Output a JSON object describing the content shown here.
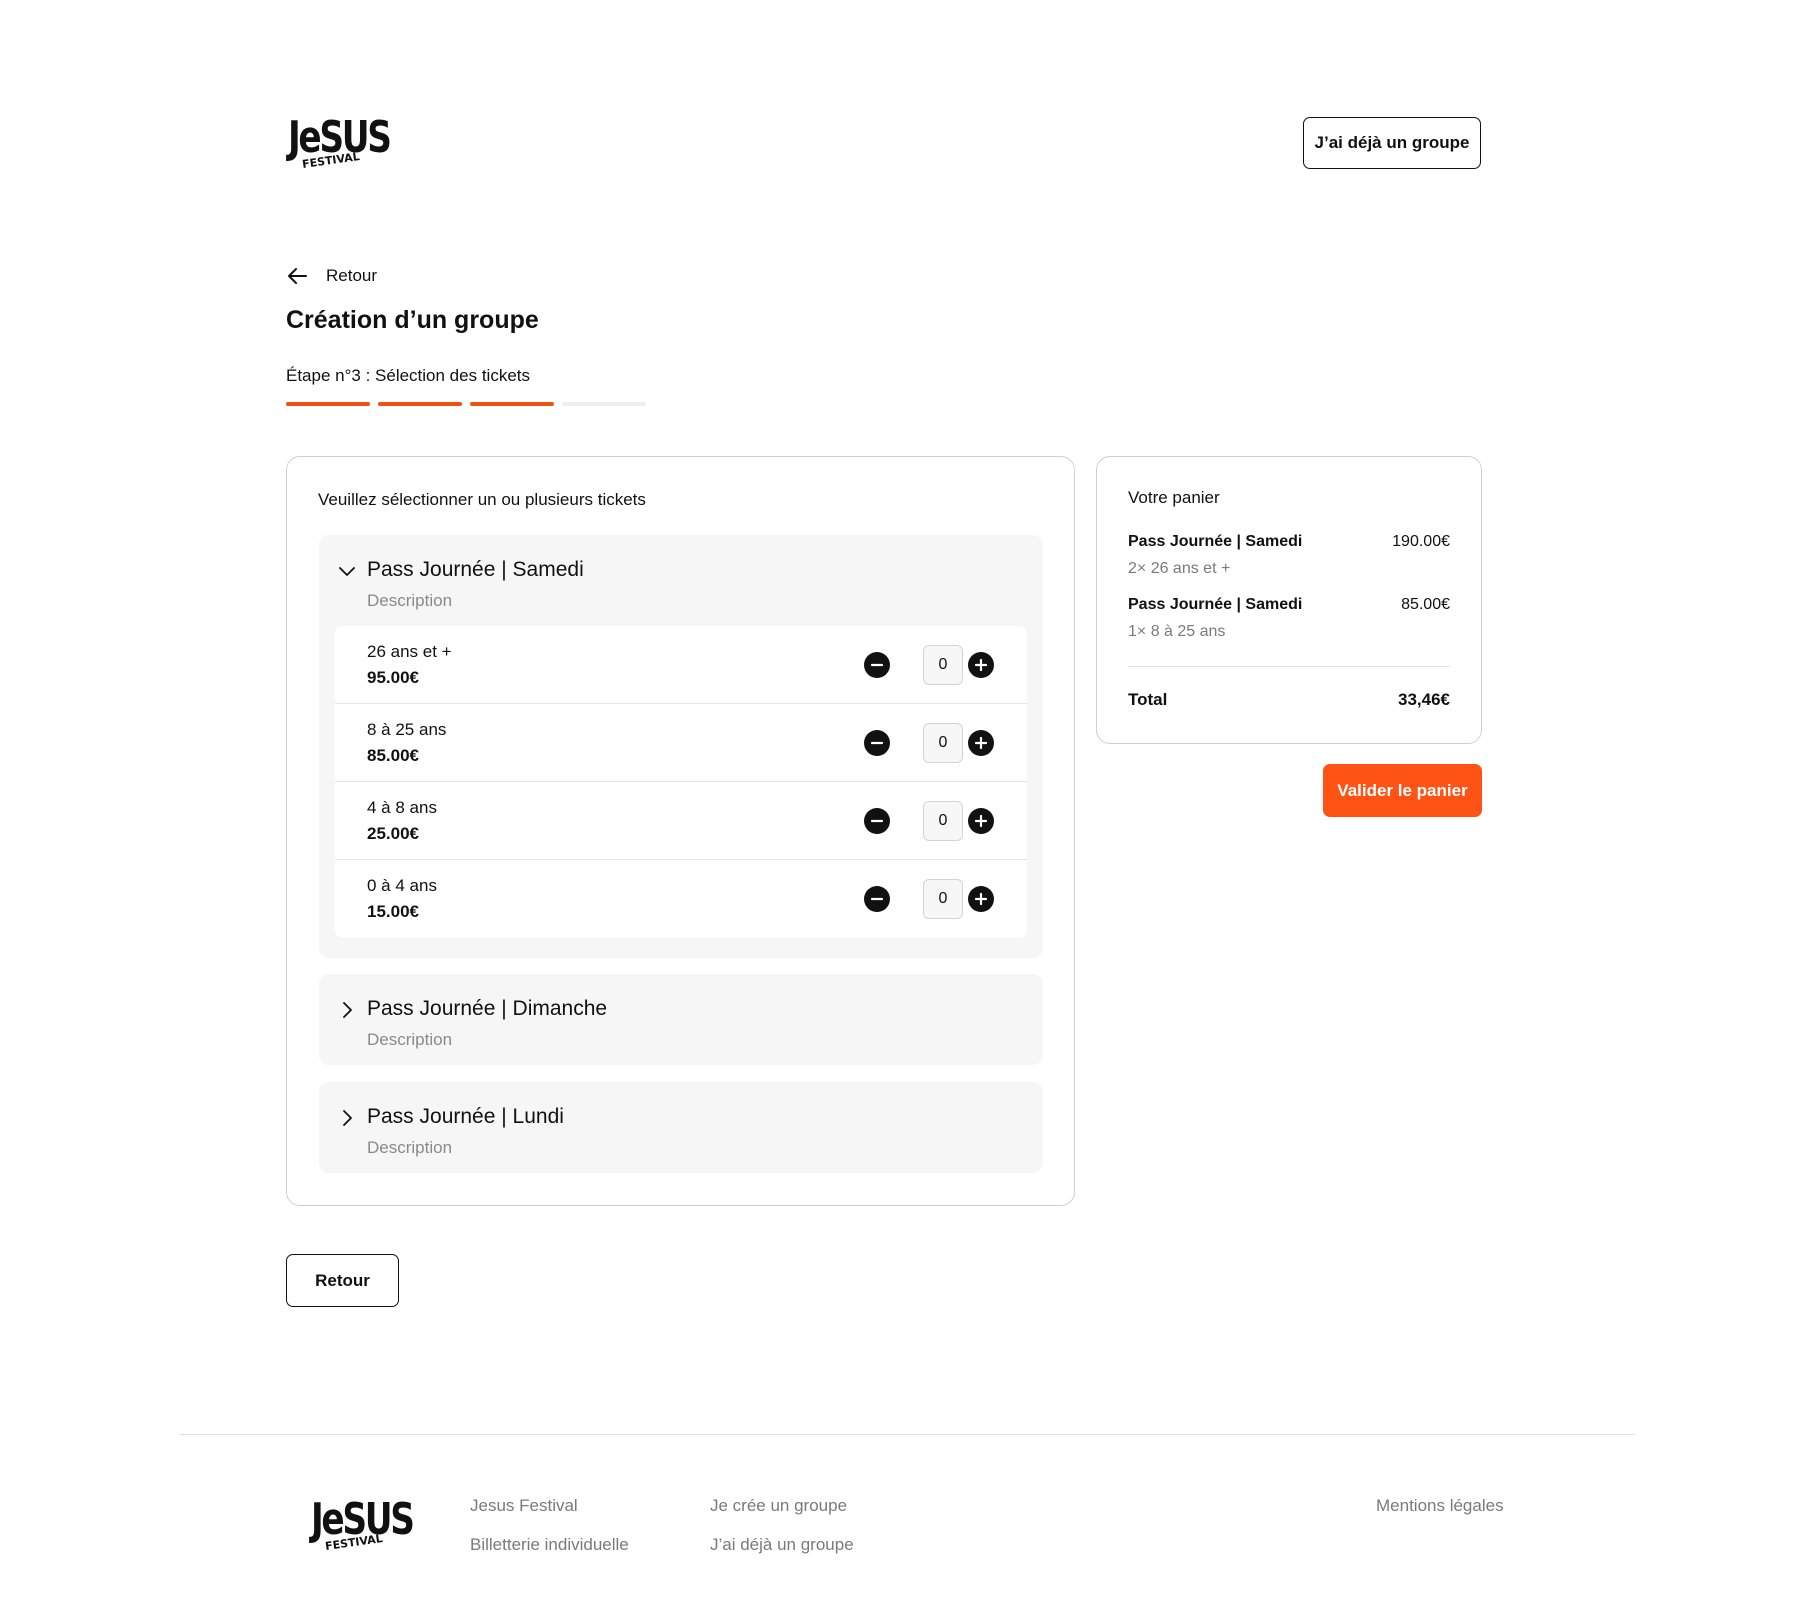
{
  "header": {
    "logo_text": "JeSUS",
    "logo_sub": "FESTIVAL",
    "group_button": "J’ai déjà un groupe"
  },
  "nav": {
    "back_label": "Retour"
  },
  "page": {
    "title": "Création d’un groupe",
    "step_label": "Étape n°3 : Sélection des tickets",
    "step_progress": {
      "current": 3,
      "total": 4
    }
  },
  "tickets_card": {
    "instructions": "Veuillez sélectionner un ou plusieurs tickets",
    "passes": [
      {
        "title": "Pass Journée | Samedi",
        "description": "Description",
        "expanded": true,
        "tickets": [
          {
            "label": "26 ans et +",
            "price": "95.00€",
            "qty": "0"
          },
          {
            "label": "8 à 25 ans",
            "price": "85.00€",
            "qty": "0"
          },
          {
            "label": "4 à 8 ans",
            "price": "25.00€",
            "qty": "0"
          },
          {
            "label": "0 à 4 ans",
            "price": "15.00€",
            "qty": "0"
          }
        ]
      },
      {
        "title": "Pass Journée | Dimanche",
        "description": "Description",
        "expanded": false
      },
      {
        "title": "Pass Journée | Lundi",
        "description": "Description",
        "expanded": false
      }
    ]
  },
  "cart": {
    "title": "Votre panier",
    "items": [
      {
        "name": "Pass Journée | Samedi",
        "detail": "2× 26 ans et +",
        "price": "190.00€"
      },
      {
        "name": "Pass Journée | Samedi",
        "detail": "1× 8 à 25 ans",
        "price": "85.00€"
      }
    ],
    "total_label": "Total",
    "total_value": "33,46€",
    "validate_button": "Valider le panier"
  },
  "bottom": {
    "back_button": "Retour"
  },
  "footer": {
    "logo_text": "JeSUS",
    "logo_sub": "FESTIVAL",
    "links_col1": [
      "Jesus Festival",
      "Billetterie individuelle"
    ],
    "links_col2": [
      "Je crée un groupe",
      "J’ai déjà un groupe"
    ],
    "legal": "Mentions légales"
  },
  "colors": {
    "accent": "#fe5314",
    "progress_done": "#f24f16",
    "progress_todo": "#eeeeee",
    "panel_bg": "#f6f6f6"
  },
  "icons": [
    "arrow-left-icon",
    "chevron-down-icon",
    "chevron-right-icon",
    "minus-icon",
    "plus-icon"
  ]
}
